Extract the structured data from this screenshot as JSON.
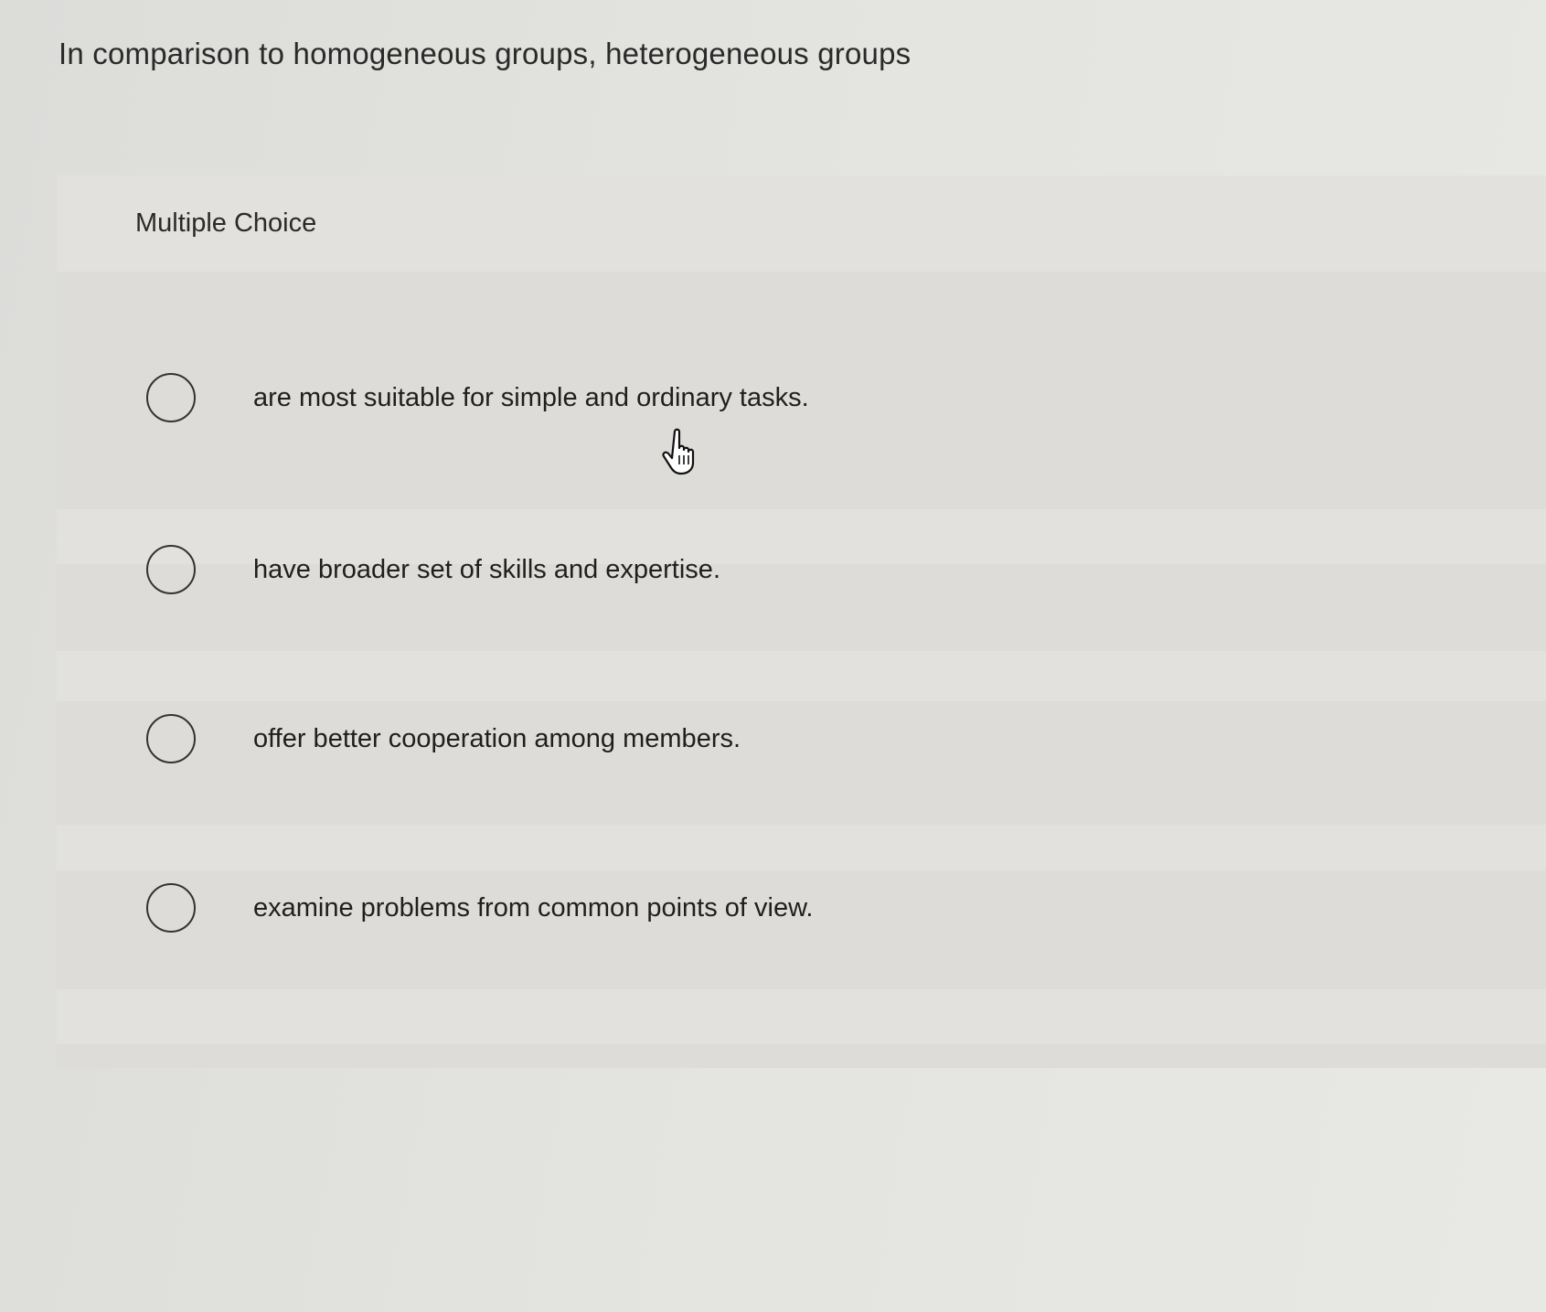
{
  "question": {
    "text": "In comparison to homogeneous groups, heterogeneous groups"
  },
  "question_type": "Multiple Choice",
  "choices": [
    {
      "label": "are most suitable for simple and ordinary tasks.",
      "selected": false
    },
    {
      "label": "have broader set of skills and expertise.",
      "selected": false
    },
    {
      "label": "offer better cooperation among members.",
      "selected": false
    },
    {
      "label": "examine problems from common points of view.",
      "selected": false
    }
  ],
  "cursor": {
    "icon": "hand-pointer-icon"
  }
}
